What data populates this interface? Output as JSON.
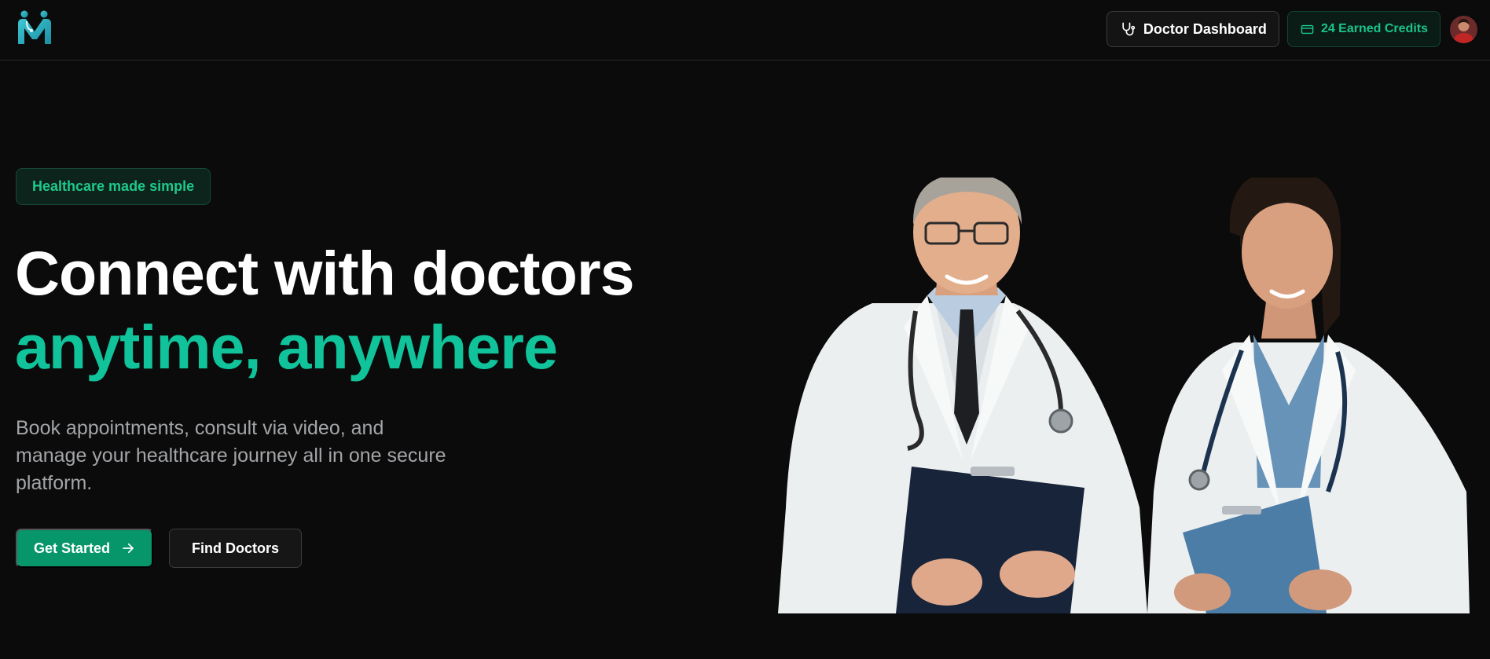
{
  "header": {
    "logo_alt": "",
    "dashboard_label": "Doctor Dashboard",
    "dashboard_icon": "stethoscope-icon",
    "credits_label": "24 Earned Credits",
    "credits_icon": "credit-card-icon",
    "avatar": "user-avatar"
  },
  "hero": {
    "badge": "Healthcare made simple",
    "title_line1": "Connect with doctors",
    "title_line2": "anytime, anywhere",
    "description": "Book appointments, consult via video, and manage your healthcare journey all in one secure platform.",
    "primary_cta": "Get Started",
    "primary_cta_icon": "arrow-right-icon",
    "secondary_cta": "Find Doctors",
    "image": "two-doctors-illustration"
  },
  "colors": {
    "background": "#0b0b0b",
    "accent": "#10c39a",
    "primary_button": "#07966a",
    "credits_text": "#19c48a"
  }
}
